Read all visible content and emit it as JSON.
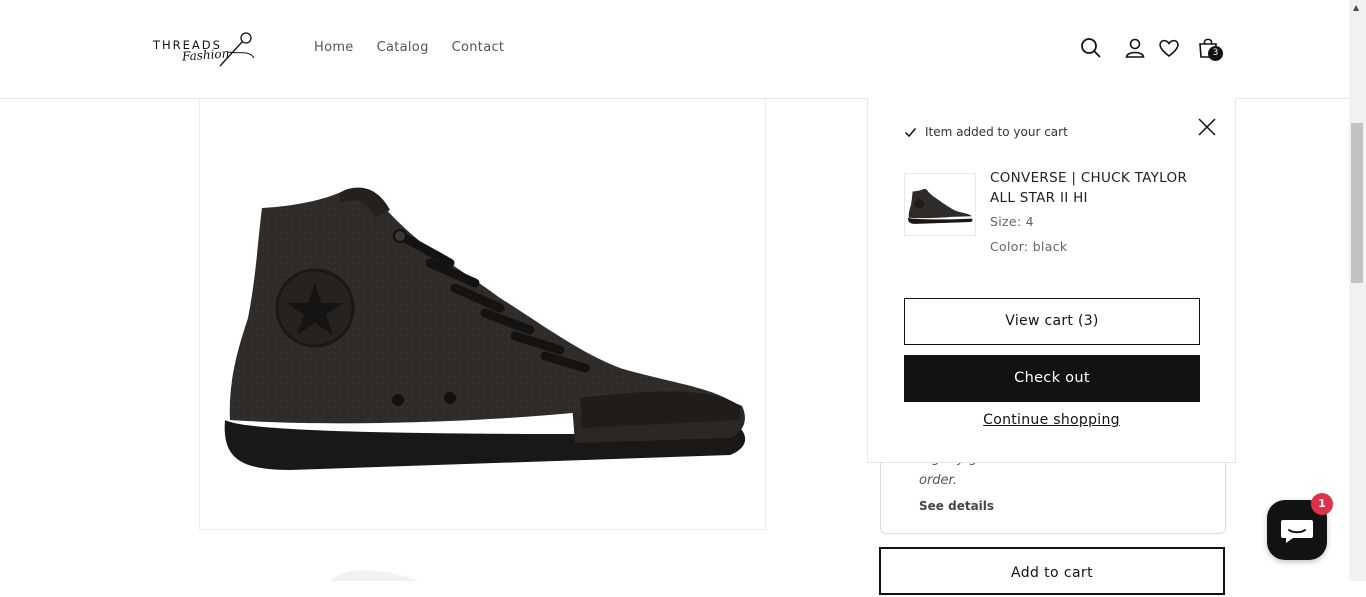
{
  "brand": {
    "name": "THREADS",
    "tagline": "Fashion"
  },
  "nav": [
    "Home",
    "Catalog",
    "Contact"
  ],
  "header_icons": [
    "search-icon",
    "account-icon",
    "wishlist-heart-icon",
    "cart-bag-icon"
  ],
  "cart": {
    "count": "3"
  },
  "notification": {
    "status": "Item added to your cart",
    "product_title": "CONVERSE | CHUCK TAYLOR ALL STAR II HI",
    "size": "Size: 4",
    "color": "Color: black",
    "view_cart_label": "View cart (3)",
    "checkout_label": "Check out",
    "continue_label": "Continue shopping"
  },
  "pickup": {
    "line_partial": "…g                              …y             g",
    "order_text": "order.",
    "see_details": "See details"
  },
  "add_to_cart_label": "Add to cart",
  "chat": {
    "badge": "1"
  },
  "colors": {
    "primary": "#121212",
    "badge": "#e0304a",
    "border": "#dcdcdc"
  }
}
